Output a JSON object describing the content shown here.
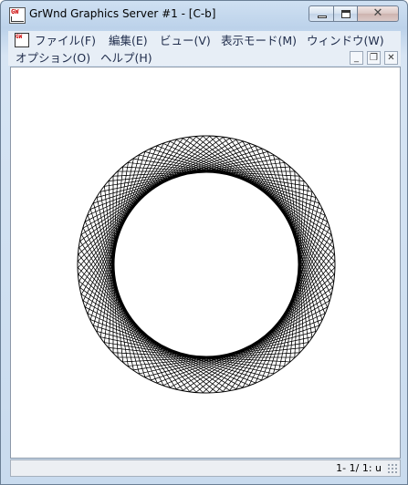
{
  "window": {
    "title": "GrWnd Graphics Server #1 - [C-b]",
    "icon": "app-icon"
  },
  "menu": {
    "items_row1": [
      "ファイル(F)",
      "編集(E)",
      "ビュー(V)",
      "表示モード(M)",
      "ウィンドウ(W)"
    ],
    "items_row2": [
      "オプション(O)",
      "ヘルプ(H)"
    ]
  },
  "canvas": {
    "figure": "concentric-ring-moire",
    "stroke_color": "#000000",
    "background": "#ffffff"
  },
  "statusbar": {
    "text": "1- 1/ 1: u"
  }
}
